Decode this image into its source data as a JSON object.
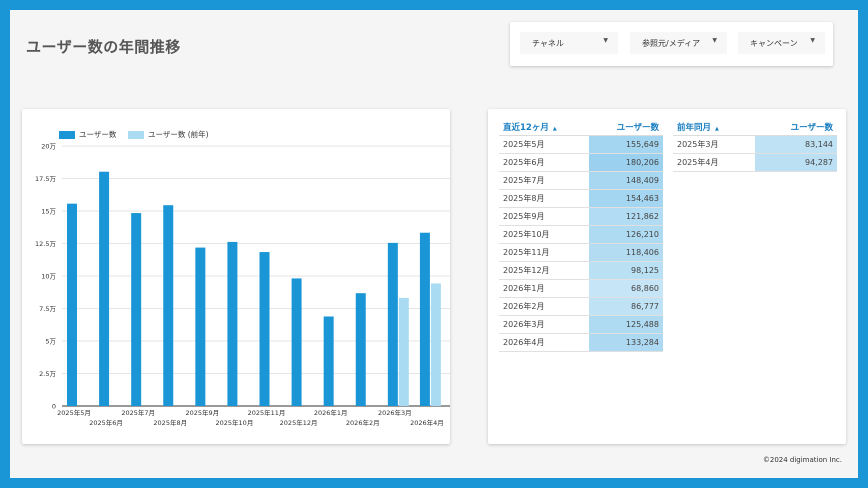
{
  "title": "ユーザー数の年間推移",
  "filters": [
    {
      "label": "チャネル"
    },
    {
      "label": "参照元/メディア"
    },
    {
      "label": "キャンペーン"
    }
  ],
  "colors": {
    "current": "#1a96d6",
    "previous": "#a9dcf2"
  },
  "chart_data": {
    "type": "bar",
    "legend": [
      "ユーザー数",
      "ユーザー数 (前年)"
    ],
    "categories": [
      "2025年5月",
      "2025年6月",
      "2025年7月",
      "2025年8月",
      "2025年9月",
      "2025年10月",
      "2025年11月",
      "2025年12月",
      "2026年1月",
      "2026年2月",
      "2026年3月",
      "2026年4月"
    ],
    "series": [
      {
        "name": "ユーザー数",
        "values": [
          155649,
          180206,
          148409,
          154463,
          121862,
          126210,
          118406,
          98125,
          68860,
          86777,
          125488,
          133284
        ]
      },
      {
        "name": "ユーザー数 (前年)",
        "values": [
          null,
          null,
          null,
          null,
          null,
          null,
          null,
          null,
          null,
          null,
          83144,
          94287
        ]
      }
    ],
    "ylim": [
      0,
      200000
    ],
    "yticks": [
      "0",
      "2.5万",
      "5万",
      "7.5万",
      "10万",
      "12.5万",
      "15万",
      "17.5万",
      "20万"
    ],
    "grid": true,
    "legend_position": "top-left"
  },
  "table1": {
    "headers": [
      "直近12ヶ月",
      "ユーザー数"
    ],
    "sort_icon": "▲",
    "rows": [
      {
        "month": "2025年5月",
        "users": "155,649",
        "level": 0.86
      },
      {
        "month": "2025年6月",
        "users": "180,206",
        "level": 1.0
      },
      {
        "month": "2025年7月",
        "users": "148,409",
        "level": 0.82
      },
      {
        "month": "2025年8月",
        "users": "154,463",
        "level": 0.86
      },
      {
        "month": "2025年9月",
        "users": "121,862",
        "level": 0.68
      },
      {
        "month": "2025年10月",
        "users": "126,210",
        "level": 0.7
      },
      {
        "month": "2025年11月",
        "users": "118,406",
        "level": 0.66
      },
      {
        "month": "2025年12月",
        "users": "98,125",
        "level": 0.54
      },
      {
        "month": "2026年1月",
        "users": "68,860",
        "level": 0.38
      },
      {
        "month": "2026年2月",
        "users": "86,777",
        "level": 0.48
      },
      {
        "month": "2026年3月",
        "users": "125,488",
        "level": 0.7
      },
      {
        "month": "2026年4月",
        "users": "133,284",
        "level": 0.74
      }
    ]
  },
  "table2": {
    "headers": [
      "前年同月",
      "ユーザー数"
    ],
    "sort_icon": "▲",
    "rows": [
      {
        "month": "2025年3月",
        "users": "83,144",
        "level": 0.46
      },
      {
        "month": "2025年4月",
        "users": "94,287",
        "level": 0.52
      }
    ]
  },
  "footer": "©2024 digimation Inc."
}
